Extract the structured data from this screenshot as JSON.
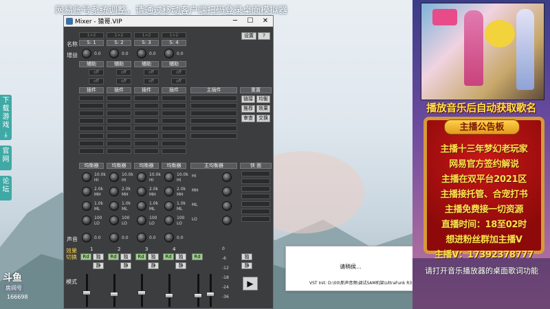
{
  "top_banner": "网易账号系统调整，请通过移动客户端扫码登录桌面模拟器",
  "side_tabs": [
    {
      "label": "下载游戏"
    },
    {
      "label": "官网"
    },
    {
      "label": "论坛"
    }
  ],
  "douyu": {
    "logo": "斗鱼",
    "room_label": "房间号",
    "room_number": "166698"
  },
  "mixer": {
    "title": "Mixer - 猿哥.VIP",
    "row_labels": {
      "name": "名称",
      "gain": "增益",
      "sound": "声音"
    },
    "channel_names": [
      "S: 1",
      "S: 2",
      "S: 3",
      "S: 4"
    ],
    "top_selects": [
      "1>2",
      "1>2",
      "1>2",
      "1>2"
    ],
    "knob_value": "0.0",
    "aux_label": "辅助",
    "off_label": "off",
    "insert_label": "插件",
    "main_insert_label": "主插件",
    "reset_label": "重置",
    "panel_buttons": [
      "链接",
      "均衡",
      "推荐",
      "效果",
      "审查",
      "交换"
    ],
    "settings_button": "设置",
    "help_button": "?",
    "eq_label": "均衡器",
    "main_eq_label": "主均衡器",
    "fast_label": "快 面",
    "eq_bands": [
      "HI",
      "MH",
      "ML",
      "LO"
    ],
    "eq_freqs": [
      "10.0k",
      "2.0k",
      "1.0k",
      "100"
    ],
    "eq_values": [
      "0.0",
      "0.0",
      "0.0",
      "0.0"
    ],
    "channel_numbers": [
      "1",
      "2",
      "3",
      "4"
    ],
    "main_out_label": "输出",
    "rd_label": "Rd",
    "solo_label": "独",
    "mute_label": "静",
    "mode_switch": "效果切换",
    "mode_label": "模式",
    "record_label": "录音",
    "main_vu_ticks": [
      "0",
      "-6",
      "-12",
      "-18",
      "-24",
      "-36"
    ],
    "right_controls": [
      "独",
      "静"
    ],
    "play_button": "▶"
  },
  "loading_dialog": {
    "message": "请稍侯...",
    "path": "VST Init: D:\\00\\新声音频\\调试SAM机架\\UltraFunk R3"
  },
  "stream_panel": {
    "headline": "播放音乐后自动获取歌名",
    "board_title": "主播公告板",
    "board_lines": [
      "主播十三年梦幻老玩家",
      "网易官方签约解说",
      "主播在双平台2021区",
      "主播接托管、合宠打书",
      "主播免费接一切资源",
      "直播时间：18至02时",
      "想进粉丝群加主播V",
      "主播V：17392378777"
    ],
    "ticker": "请打开音乐播放器的桌面歌词功能"
  },
  "colors": {
    "accent_teal": "#3fa9a6",
    "board_red": "#b81010",
    "headline_yellow": "#ffe34a"
  }
}
